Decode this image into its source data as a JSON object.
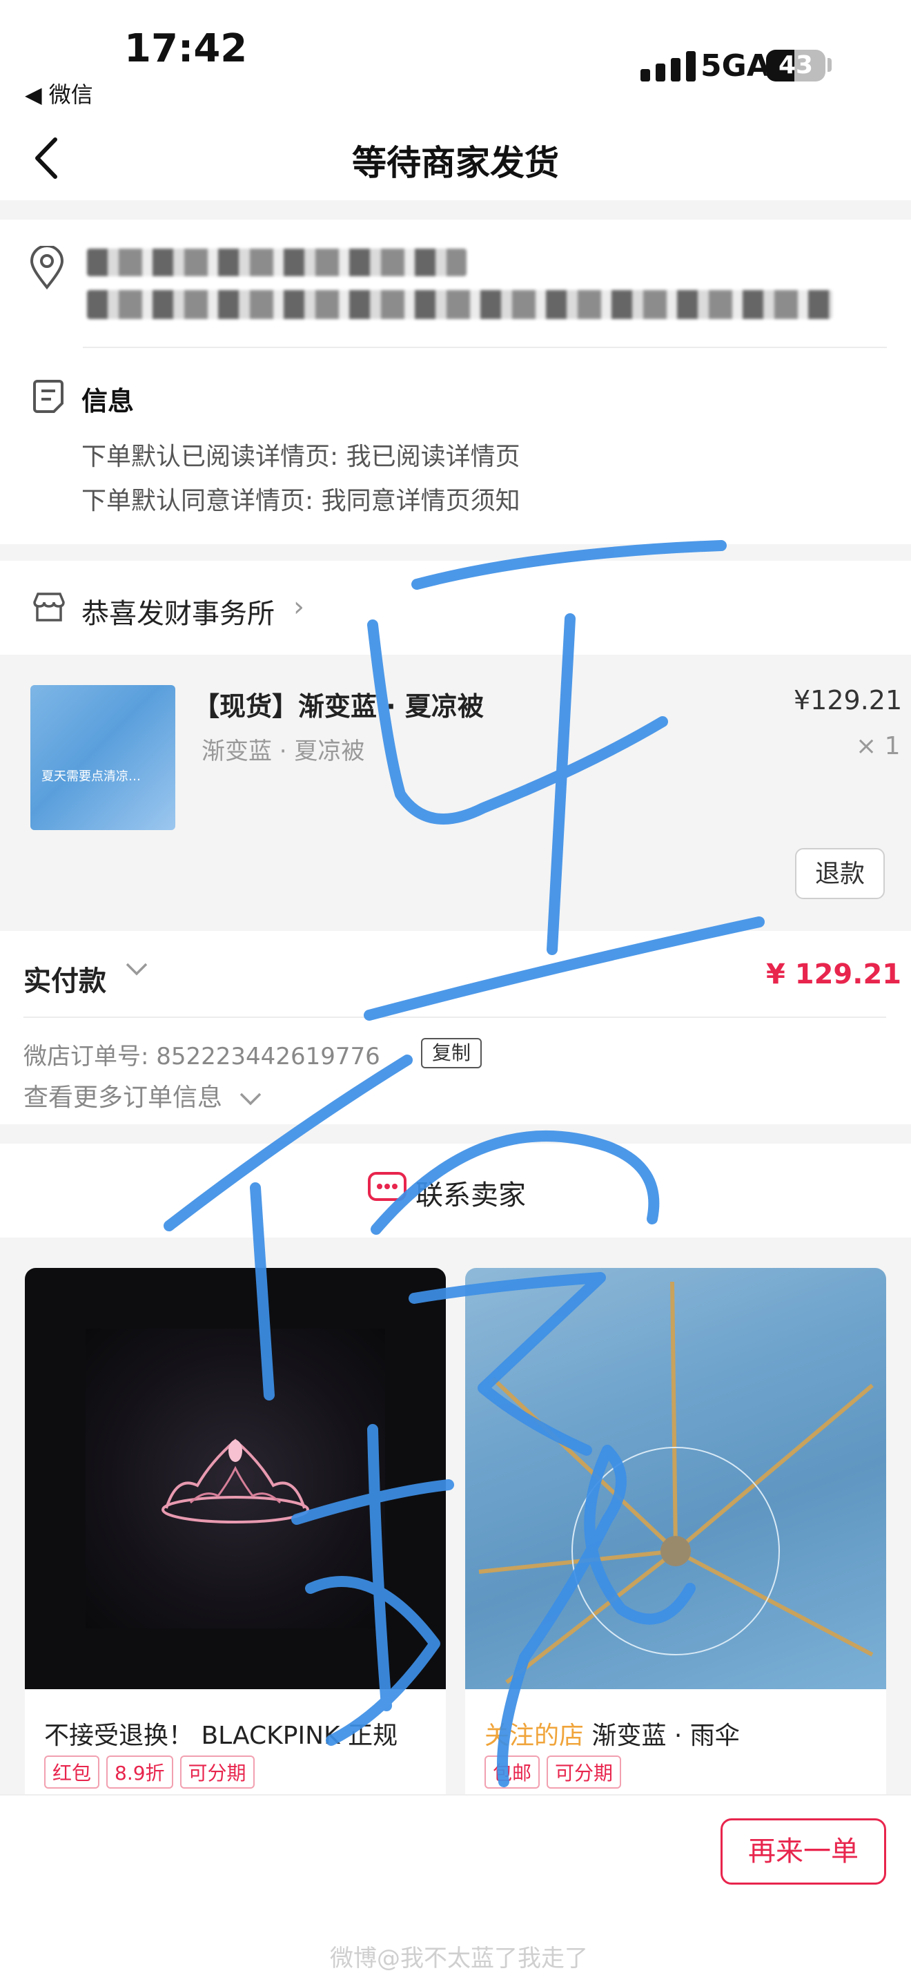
{
  "status_bar": {
    "time": "17:42",
    "back_app": "◀ 微信",
    "network": "5GA",
    "battery": "43"
  },
  "nav": {
    "title": "等待商家发货"
  },
  "address": {
    "icon": "location-pin-icon"
  },
  "note": {
    "title": "信息",
    "lines": [
      "下单默认已阅读详情页: 我已阅读详情页",
      "下单默认同意详情页: 我同意详情页须知"
    ]
  },
  "shop": {
    "name": "恭喜发财事务所",
    "chevron": "›"
  },
  "product": {
    "title": "【现货】渐变蓝 · 夏凉被",
    "spec": "渐变蓝 · 夏凉被",
    "price": "¥129.21",
    "quantity": "× 1",
    "thumb_caption": "夏天需要点清凉…",
    "refund_label": "退款"
  },
  "payment": {
    "label": "实付款",
    "amount": "¥ 129.21",
    "order_label": "微店订单号:  852223442619776",
    "copy_label": "复制",
    "more_label": "查看更多订单信息"
  },
  "contact": {
    "label": "联系卖家"
  },
  "recommendations": [
    {
      "title": "不接受退换！  BLACKPINK 正规",
      "follow_prefix": "",
      "tags": [
        "红包",
        "8.9折",
        "可分期"
      ]
    },
    {
      "title": "渐变蓝 · 雨伞",
      "follow_prefix": "关注的店",
      "tags": [
        "包邮",
        "可分期"
      ]
    }
  ],
  "bottom": {
    "reorder_label": "再来一单"
  },
  "watermark": "微博@我不太蓝了我走了",
  "colors": {
    "accent_red": "#e8254d",
    "scribble_blue": "#3d8fe6",
    "follow_orange": "#f0a43a"
  }
}
